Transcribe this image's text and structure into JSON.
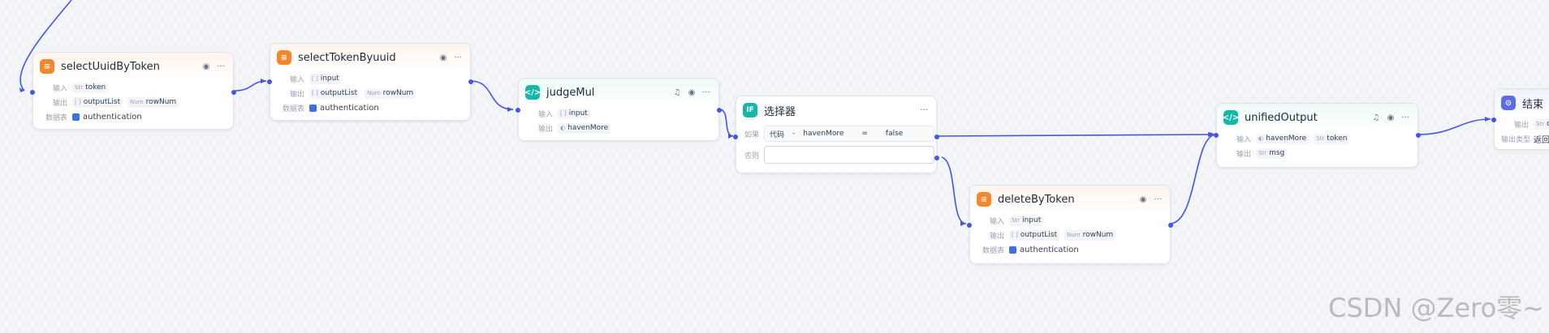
{
  "labels": {
    "input": "输入",
    "output": "输出",
    "table": "数据表",
    "output_type": "输出类型"
  },
  "nodes": {
    "selectUuidByToken": {
      "title": "selectUuidByToken",
      "input": [
        {
          "type": "Str",
          "name": "token"
        }
      ],
      "output": [
        {
          "type": "[ ]",
          "name": "outputList"
        },
        {
          "type": "Num",
          "name": "rowNum"
        }
      ],
      "table": "authentication"
    },
    "selectTokenByuuid": {
      "title": "selectTokenByuuid",
      "input": [
        {
          "type": "[ ]",
          "name": "input"
        }
      ],
      "output": [
        {
          "type": "[ ]",
          "name": "outputList"
        },
        {
          "type": "Num",
          "name": "rowNum"
        }
      ],
      "table": "authentication"
    },
    "judgeMul": {
      "title": "judgeMul",
      "input": [
        {
          "type": "[ ]",
          "name": "input"
        }
      ],
      "output": [
        {
          "type": "◐",
          "name": "havenMore"
        }
      ]
    },
    "selector": {
      "title": "选择器",
      "if_label": "如果",
      "condition": {
        "source": "代码",
        "sep": "-",
        "var": "havenMore",
        "op": "=",
        "value": "false"
      },
      "else_label": "否则"
    },
    "deleteByToken": {
      "title": "deleteByToken",
      "input": [
        {
          "type": "Str",
          "name": "input"
        }
      ],
      "output": [
        {
          "type": "[ ]",
          "name": "outputList"
        },
        {
          "type": "Num",
          "name": "rowNum"
        }
      ],
      "table": "authentication"
    },
    "unifiedOutput": {
      "title": "unifiedOutput",
      "input": [
        {
          "type": "◐",
          "name": "havenMore"
        },
        {
          "type": "Str",
          "name": "token"
        }
      ],
      "output": [
        {
          "type": "Str",
          "name": "msg"
        }
      ]
    },
    "end": {
      "title": "结束",
      "output_tag": {
        "type": "Str",
        "name": "o"
      },
      "output_type_value": "返回"
    }
  },
  "watermark": "CSDN @Zero零~",
  "colors": {
    "edge": "#4456e8",
    "db_icon": "#f7852b",
    "code_icon": "#14b8a6",
    "end_icon": "#5b6cf0"
  }
}
